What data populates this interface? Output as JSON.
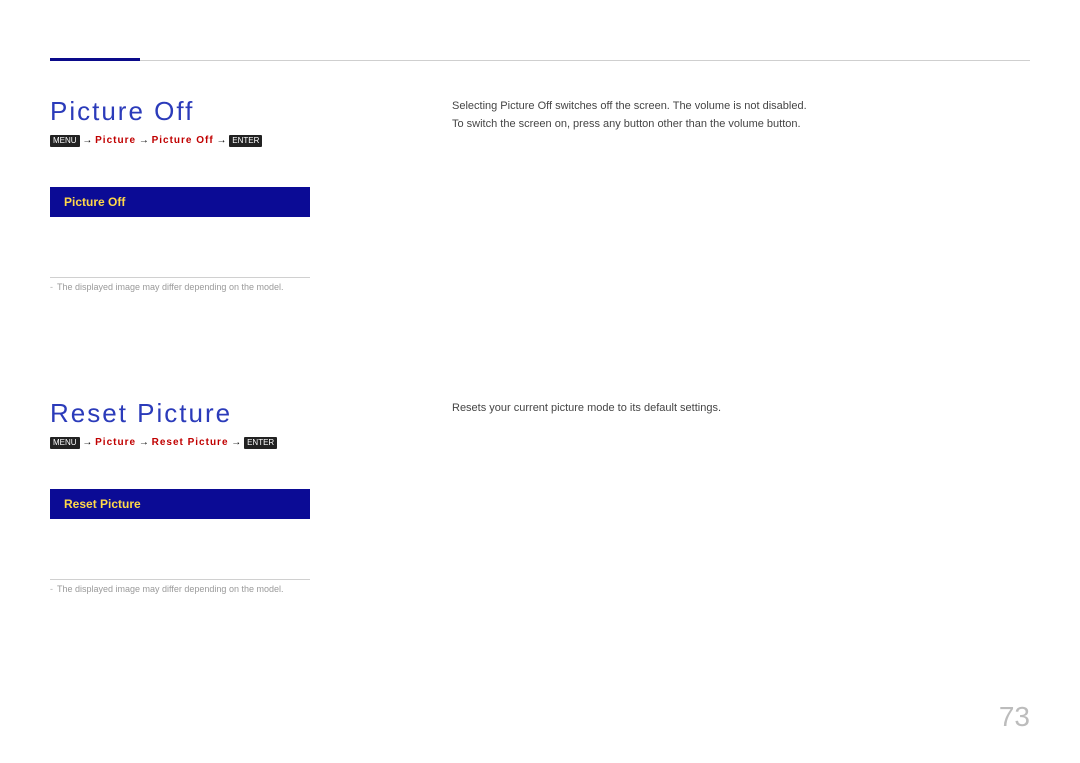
{
  "page_number": "73",
  "sections": [
    {
      "title": "Picture Off",
      "breadcrumb": {
        "key_menu": "MENU",
        "path1": "Picture",
        "path2": "Picture Off",
        "key_enter": "ENTER"
      },
      "menu_item_label": "Picture Off",
      "footnote": "The displayed image may differ depending on the model.",
      "body_lines": [
        "Selecting Picture Off switches off the screen. The volume is not disabled.",
        "To switch the screen on, press any button other than the volume button."
      ]
    },
    {
      "title": "Reset Picture",
      "breadcrumb": {
        "key_menu": "MENU",
        "path1": "Picture",
        "path2": "Reset Picture",
        "key_enter": "ENTER"
      },
      "menu_item_label": "Reset Picture",
      "footnote": "The displayed image may differ depending on the model.",
      "body_lines": [
        "Resets your current picture mode to its default settings."
      ]
    }
  ]
}
